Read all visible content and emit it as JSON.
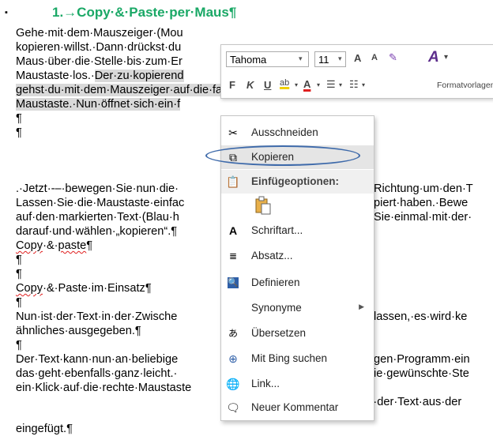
{
  "document": {
    "bullet": "▪",
    "heading": "1.→Copy·&·Paste·per·Maus¶",
    "lines": [
      "Gehe·mit·dem·Mauszeiger·(Mou",
      "kopieren·willst.·Dann·drückst·du",
      "Maus·über·die·Stelle·bis·zum·Er",
      "Maustaste·los.·",
      "Der·zu·kopierend",
      "gehst·du·mit·dem·Mauszeiger·auf·die·farbig·hinterlegte·Textstelle·und·kli",
      "Maustaste.·Nun·öffnet·sich·ein·f",
      "¶",
      "¶",
      ".·Jetzt·‑–·bewegen·Sie·nun·die·",
      "Richtung·um·den·T",
      "Lassen·Sie·die·Maustaste·einfac",
      "piert·haben.·Bewe",
      "auf·den·markierten·Text·(Blau·h",
      "Sie·einmal·mit·der·",
      "darauf·und·wählen·„kopieren“.¶",
      "Copy",
      "·&·",
      "paste",
      "¶",
      "¶",
      "Copy",
      "·&·Paste·im·Einsatz¶",
      "¶",
      "Nun·ist·der·Text·in·der·Zwische",
      "lassen,·es·wird·ke",
      "ähnliches·ausgegeben.¶",
      "¶",
      "Der·Text·kann·nun·an·beliebige",
      "gen·Programm·ein",
      "das·geht·ebenfalls·ganz·leicht.·",
      "ie·gewünschte·Ste",
      "ein·Klick·auf·die·rechte·Maustaste",
      "Einfügen.·Schon·ist·der·Text·aus·der",
      "eingefügt.¶"
    ]
  },
  "mini_toolbar": {
    "font_name": "Tahoma",
    "font_size": "11",
    "grow_font": "A",
    "shrink_font": "A",
    "bold": "F",
    "italic": "K",
    "underline": "U",
    "highlight": "ab",
    "font_color": "A",
    "styles_label": "Formatvorlagen"
  },
  "context_menu": {
    "items": [
      {
        "label": "Ausschneiden",
        "icon": "scissors-icon"
      },
      {
        "label": "Kopieren",
        "icon": "copy-icon"
      },
      {
        "label": "Einfügeoptionen:",
        "icon": "paste-icon"
      },
      {
        "label": "Schriftart...",
        "icon": "font-icon"
      },
      {
        "label": "Absatz...",
        "icon": "paragraph-icon"
      },
      {
        "label": "Definieren",
        "icon": "define-icon"
      },
      {
        "label": "Synonyme",
        "icon": ""
      },
      {
        "label": "Übersetzen",
        "icon": "translate-icon"
      },
      {
        "label": "Mit Bing suchen",
        "icon": "search-icon"
      },
      {
        "label": "Link...",
        "icon": "link-icon"
      },
      {
        "label": "Neuer Kommentar",
        "icon": "comment-icon"
      }
    ]
  },
  "colors": {
    "heading": "#1aa866",
    "highlight": "#d9d9d9",
    "annotation_oval": "#3e6aaa"
  }
}
